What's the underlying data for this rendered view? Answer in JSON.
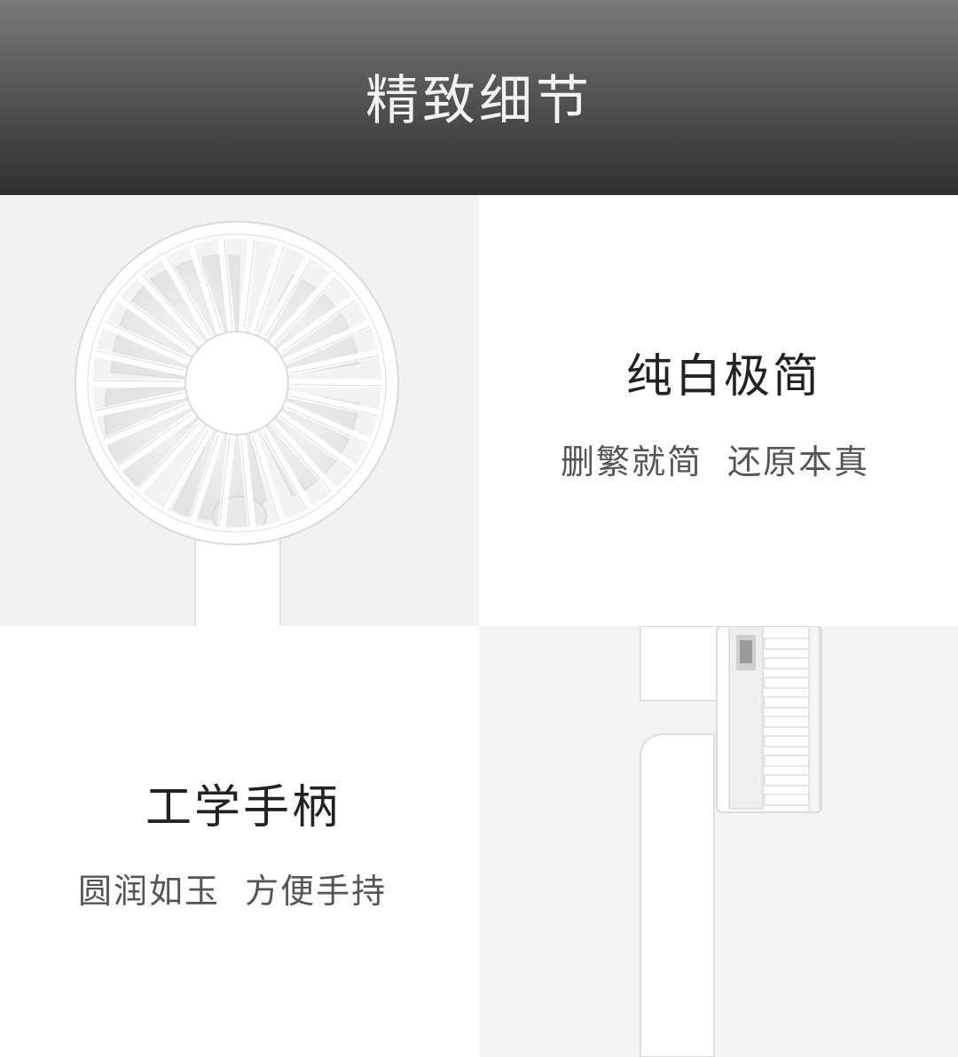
{
  "banner": {
    "title": "精致细节"
  },
  "features": [
    {
      "title": "纯白极简",
      "subtitle": "删繁就简  还原本真"
    },
    {
      "title": "工学手柄",
      "subtitle": "圆润如玉  方便手持"
    }
  ],
  "colors": {
    "banner_top": "#7a7a7a",
    "banner_bottom": "#2f2f2f",
    "title_text": "#222222",
    "subtitle_text": "#555555",
    "fan_white": "#ffffff",
    "fan_shadow": "#d8d8d8"
  },
  "images": [
    {
      "name": "fan-front-view"
    },
    {
      "name": "fan-side-view"
    }
  ]
}
